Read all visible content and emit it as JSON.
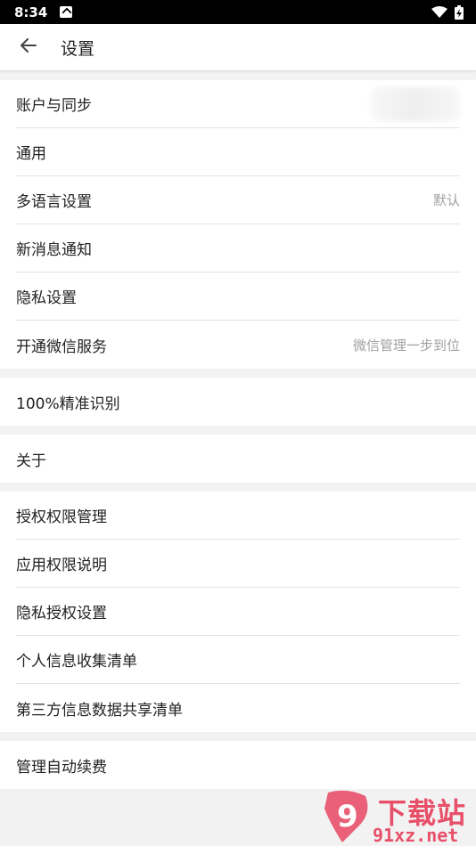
{
  "status_bar": {
    "time": "8:34"
  },
  "header": {
    "title": "设置"
  },
  "groups": [
    {
      "items": [
        {
          "label": "账户与同步",
          "value": ""
        },
        {
          "label": "通用",
          "value": ""
        },
        {
          "label": "多语言设置",
          "value": "默认"
        },
        {
          "label": "新消息通知",
          "value": ""
        },
        {
          "label": "隐私设置",
          "value": ""
        },
        {
          "label": "开通微信服务",
          "value": "微信管理一步到位"
        }
      ]
    },
    {
      "items": [
        {
          "label": "100%精准识别",
          "value": ""
        }
      ]
    },
    {
      "items": [
        {
          "label": "关于",
          "value": ""
        }
      ]
    },
    {
      "items": [
        {
          "label": "授权权限管理",
          "value": ""
        },
        {
          "label": "应用权限说明",
          "value": ""
        },
        {
          "label": "隐私授权设置",
          "value": ""
        },
        {
          "label": "个人信息收集清单",
          "value": ""
        },
        {
          "label": "第三方信息数据共享清单",
          "value": ""
        }
      ]
    },
    {
      "items": [
        {
          "label": "管理自动续费",
          "value": ""
        }
      ]
    }
  ],
  "watermark": {
    "main": "下载站",
    "sub": "91xz.net",
    "logo_text": "9"
  },
  "colors": {
    "watermark": "#e8506a",
    "divider": "#e3e3e3",
    "background": "#f2f2f2"
  }
}
